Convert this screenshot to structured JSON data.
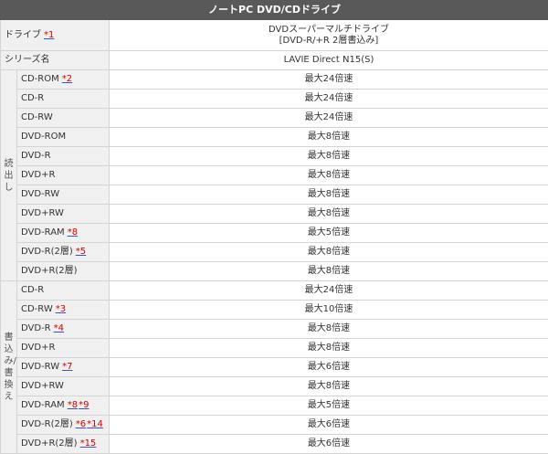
{
  "title": "ノートPC DVD/CDドライブ",
  "drive": {
    "label": "ドライブ",
    "note": "*1",
    "value_line1": "DVDスーパーマルチドライブ",
    "value_line2": "[DVD-R/+R 2層書込み]"
  },
  "series": {
    "label": "シリーズ名",
    "value": "LAVIE Direct N15(S)"
  },
  "read": {
    "group_label": "読出し",
    "rows": [
      {
        "label": "CD-ROM",
        "notes": [
          "*2"
        ],
        "value": "最大24倍速"
      },
      {
        "label": "CD-R",
        "notes": [],
        "value": "最大24倍速"
      },
      {
        "label": "CD-RW",
        "notes": [],
        "value": "最大24倍速"
      },
      {
        "label": "DVD-ROM",
        "notes": [],
        "value": "最大8倍速"
      },
      {
        "label": "DVD-R",
        "notes": [],
        "value": "最大8倍速"
      },
      {
        "label": "DVD+R",
        "notes": [],
        "value": "最大8倍速"
      },
      {
        "label": "DVD-RW",
        "notes": [],
        "value": "最大8倍速"
      },
      {
        "label": "DVD+RW",
        "notes": [],
        "value": "最大8倍速"
      },
      {
        "label": "DVD-RAM",
        "notes": [
          "*8"
        ],
        "value": "最大5倍速"
      },
      {
        "label": "DVD-R(2層)",
        "notes": [
          "*5"
        ],
        "value": "最大8倍速"
      },
      {
        "label": "DVD+R(2層)",
        "notes": [],
        "value": "最大8倍速"
      }
    ]
  },
  "write": {
    "group_label": "書込み/書換え",
    "rows": [
      {
        "label": "CD-R",
        "notes": [],
        "value": "最大24倍速"
      },
      {
        "label": "CD-RW",
        "notes": [
          "*3"
        ],
        "value": "最大10倍速"
      },
      {
        "label": "DVD-R",
        "notes": [
          "*4"
        ],
        "value": "最大8倍速"
      },
      {
        "label": "DVD+R",
        "notes": [],
        "value": "最大8倍速"
      },
      {
        "label": "DVD-RW",
        "notes": [
          "*7"
        ],
        "value": "最大6倍速"
      },
      {
        "label": "DVD+RW",
        "notes": [],
        "value": "最大8倍速"
      },
      {
        "label": "DVD-RAM",
        "notes": [
          "*8",
          "*9"
        ],
        "value": "最大5倍速"
      },
      {
        "label": "DVD-R(2層)",
        "notes": [
          "*6",
          "*14"
        ],
        "value": "最大6倍速"
      },
      {
        "label": "DVD+R(2層)",
        "notes": [
          "*15"
        ],
        "value": "最大6倍速"
      }
    ]
  }
}
